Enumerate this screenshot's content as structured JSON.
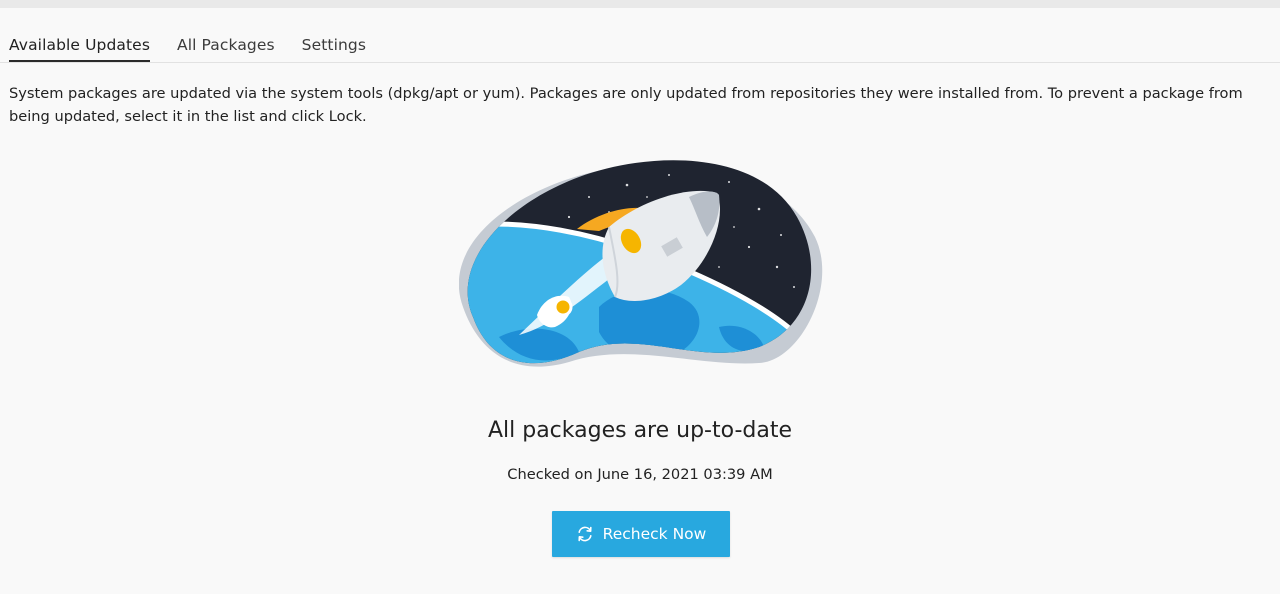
{
  "tabs": [
    {
      "label": "Available Updates",
      "active": true
    },
    {
      "label": "All Packages",
      "active": false
    },
    {
      "label": "Settings",
      "active": false
    }
  ],
  "description": "System packages are updated via the system tools (dpkg/apt or yum). Packages are only updated from repositories they were installed from. To prevent a package from being updated, select it in the list and click Lock.",
  "status": {
    "headline": "All packages are up-to-date",
    "checked": "Checked on June 16, 2021 03:39 AM"
  },
  "recheck_button": {
    "label": "Recheck Now",
    "icon": "refresh-icon"
  },
  "illustration": {
    "icon": "rocket-illustration"
  },
  "colors": {
    "accent": "#28a8df",
    "tab_indicator": "#2b2b2b",
    "space": "#1f2430",
    "ocean": "#3db3e8",
    "ring": "#c5cbd3"
  }
}
